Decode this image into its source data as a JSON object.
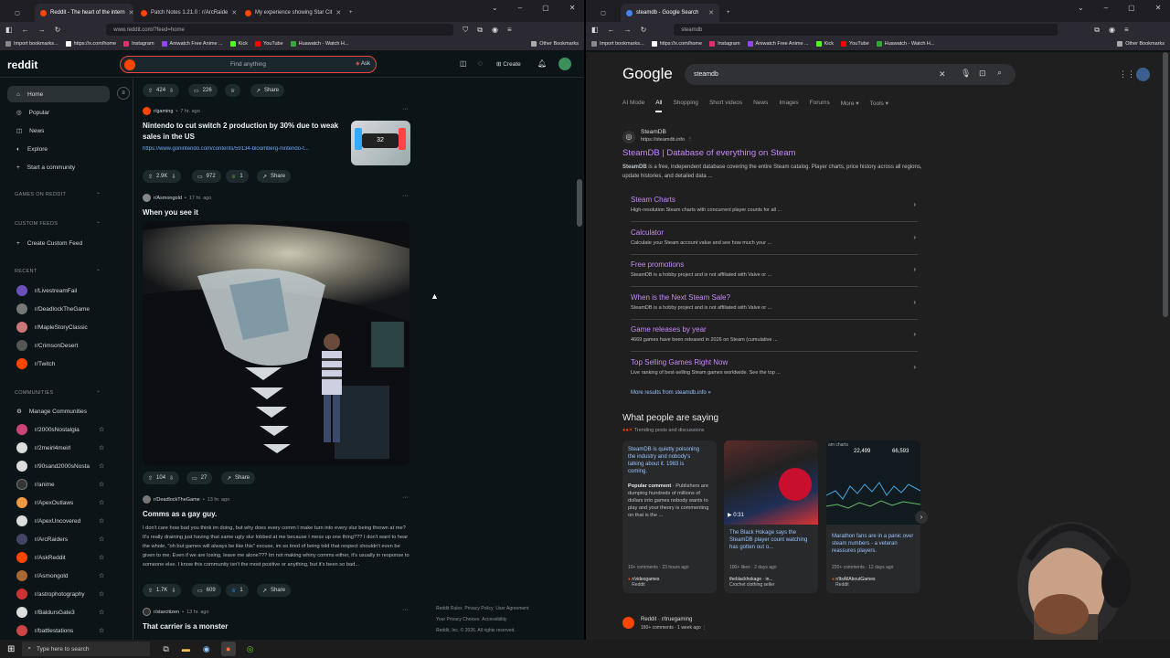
{
  "left_browser": {
    "tabs": [
      "Reddit - The heart of the intern",
      "Patch Notes 1.21.0 : r/ArcRaide",
      "My experience showing Star Cit"
    ],
    "url": "www.reddit.com/?feed=home",
    "bookmarks": [
      "Import bookmarks...",
      "https://x.com/home",
      "Instagram",
      "Aniwatch Free Anime ...",
      "Kick",
      "YouTube",
      "Huawatch - Watch H...",
      "Other Bookmarks"
    ]
  },
  "right_browser": {
    "tabs": [
      "steamdb - Google Search"
    ],
    "url": "steamdb",
    "bookmarks": [
      "Import bookmarks...",
      "https://x.com/home",
      "Instagram",
      "Aniwatch Free Anime ...",
      "Kick",
      "YouTube",
      "Huawatch - Watch H...",
      "Other Bookmarks"
    ]
  },
  "reddit": {
    "logo": "reddit",
    "search_placeholder": "Find anything",
    "ask": "Ask",
    "create": "Create",
    "sidebar": {
      "nav": [
        "Home",
        "Popular",
        "News",
        "Explore",
        "Start a community"
      ],
      "games_header": "GAMES ON REDDIT",
      "custom_header": "CUSTOM FEEDS",
      "create_feed": "Create Custom Feed",
      "recent_header": "RECENT",
      "recent": [
        "r/LivestreamFail",
        "r/DeadlockTheGame",
        "r/MapleStoryClassic",
        "r/CrimsonDesert",
        "r/Twitch"
      ],
      "communities_header": "COMMUNITIES",
      "manage": "Manage Communities",
      "communities": [
        "r/2000sNostalgia",
        "r/2meirl4meirl",
        "r/90sand2000sNostalgia",
        "r/anime",
        "r/ApexOutlaws",
        "r/ApexUncovered",
        "r/ArcRaiders",
        "r/AskReddit",
        "r/Asmongold",
        "r/astrophotography",
        "r/BaldursGate3",
        "r/battlestations"
      ]
    },
    "top_actions": {
      "votes": "424",
      "comments": "226",
      "share": "Share"
    },
    "posts": [
      {
        "sub": "r/gaming",
        "time": "7 hr. ago",
        "title": "Nintendo to cut switch 2 production by 30% due to weak sales in the US",
        "link": "https://www.gonintendo.com/contents/59134-bloomberg-nintendo-t...",
        "votes": "2.9K",
        "comments": "972",
        "awards": "1",
        "share": "Share",
        "thumb_text": "32"
      },
      {
        "sub": "r/Asmongold",
        "time": "17 hr. ago",
        "title": "When you see it",
        "votes": "104",
        "comments": "27",
        "share": "Share"
      },
      {
        "sub": "r/DeadlockTheGame",
        "time": "13 hr. ago",
        "title": "Comms as a gay guy.",
        "body": "I don't care how bad you think im doing, but why does every comm I make turn into every slur being thrown at me? It's really draining just having that same ugly slur lobbed at me because I mess up one thing??? I don't want to hear the whole, \"oh but games will always be like this\" excuse, im so tired of being told that respect shouldn't even be given to me. Even if we are losing, leave me alone??? Im not making whiny comms either, it's usually in response to someone else. I know this community isn't the most positive or anything, but it's been so bad...",
        "votes": "1.7K",
        "comments": "609",
        "awards": "1",
        "share": "Share"
      },
      {
        "sub": "r/starcitizen",
        "time": "13 hr. ago",
        "title": "That carrier is a monster"
      }
    ],
    "footer": [
      "Reddit Rules",
      "Privacy Policy",
      "User Agreement",
      "Your Privacy Choices",
      "Accessibility",
      "Reddit, Inc. © 2026. All rights reserved."
    ]
  },
  "google": {
    "logo": "Google",
    "query": "steamdb",
    "tabs": [
      "AI Mode",
      "All",
      "Shopping",
      "Short videos",
      "News",
      "Images",
      "Forums",
      "More",
      "Tools"
    ],
    "result": {
      "site": "SteamDB",
      "url": "https://steamdb.info",
      "title": "SteamDB | Database of everything on Steam",
      "snippet_bold": "SteamDB",
      "snippet": " is a free, independent database covering the entire Steam catalog. Player charts, price history across all regions, update histories, and detailed data ..."
    },
    "sitelinks": [
      {
        "t": "Steam Charts",
        "d": "High-resolution Steam charts with concurrent player counts for all ..."
      },
      {
        "t": "Calculator",
        "d": "Calculate your Steam account value and see how much your ..."
      },
      {
        "t": "Free promotions",
        "d": "SteamDB is a hobby project and is not affiliated with Valve or ..."
      },
      {
        "t": "When is the Next Steam Sale?",
        "d": "SteamDB is a hobby project and is not affiliated with Valve or ..."
      },
      {
        "t": "Game releases by year",
        "d": "4669 games have been released in 2026 on Steam (cumulative ..."
      },
      {
        "t": "Top Selling Games Right Now",
        "d": "Live ranking of best-selling Steam games worldwide. See the top ..."
      }
    ],
    "more_results": "More results from steamdb.info »",
    "people_heading": "What people are saying",
    "people_sub": "Trending posts and discussions",
    "cards": [
      {
        "title": "SteamDB is quietly poisoning the industry and nobody's talking about it. 1983 is coming.",
        "comment_label": "Popular comment",
        "comment": "Publishers are dumping hundreds of millions of dollars into games nobody wants to play and your theory is commenting on that is the ...",
        "stats": "10+ comments · 23 hours ago",
        "source": "r/videogames",
        "platform": "Reddit"
      },
      {
        "title": "The Black Hokage says the SteamDB player count watching has gotten out o...",
        "duration": "0:31",
        "stats": "100+ likes · 2 days ago",
        "source": "theblackhokage · in...",
        "platform": "Crochet clothing seller"
      },
      {
        "title": "Marathon fans are in a panic over steam numbers - a veteran reassures players.",
        "chart_label": "am charts",
        "chart_nums": [
          "22,499",
          "66,593"
        ],
        "stats": "220+ comments · 12 days ago",
        "source": "r/ItsAllAboutGames",
        "platform": "Reddit"
      }
    ],
    "bottom_result": {
      "site": "Reddit · r/truegaming",
      "meta": "160+ comments · 1 week ago"
    }
  },
  "taskbar": {
    "search": "Type here to search"
  }
}
